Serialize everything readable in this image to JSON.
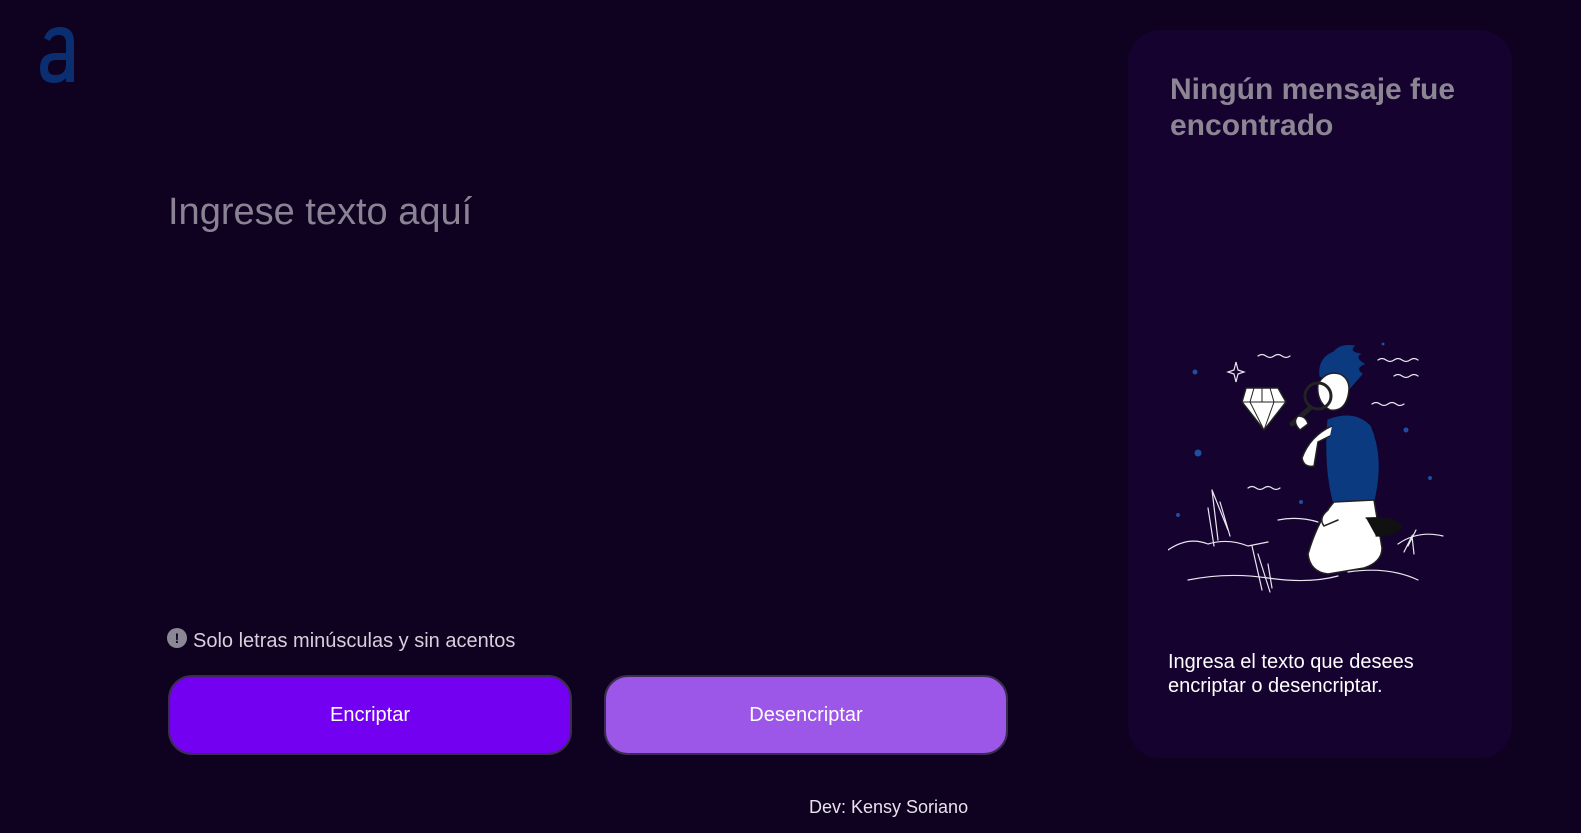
{
  "brand": {
    "logo_icon": "alura-a-logo",
    "logo_color": "#0b2e70"
  },
  "input": {
    "placeholder": "Ingrese texto aquí",
    "value": ""
  },
  "hint": {
    "icon": "exclamation-circle-icon",
    "text": "Solo letras minúsculas y sin acentos"
  },
  "buttons": {
    "encrypt_label": "Encriptar",
    "decrypt_label": "Desencriptar",
    "encrypt_color": "#7300f0",
    "decrypt_color": "#9c56e8"
  },
  "result_panel": {
    "title": "Ningún mensaje fue encontrado",
    "illustration": "person-with-magnifier-looking-at-diamond",
    "description": "Ingresa el texto que desees encriptar o desencriptar."
  },
  "footer": {
    "credit": "Dev: Kensy Soriano"
  }
}
